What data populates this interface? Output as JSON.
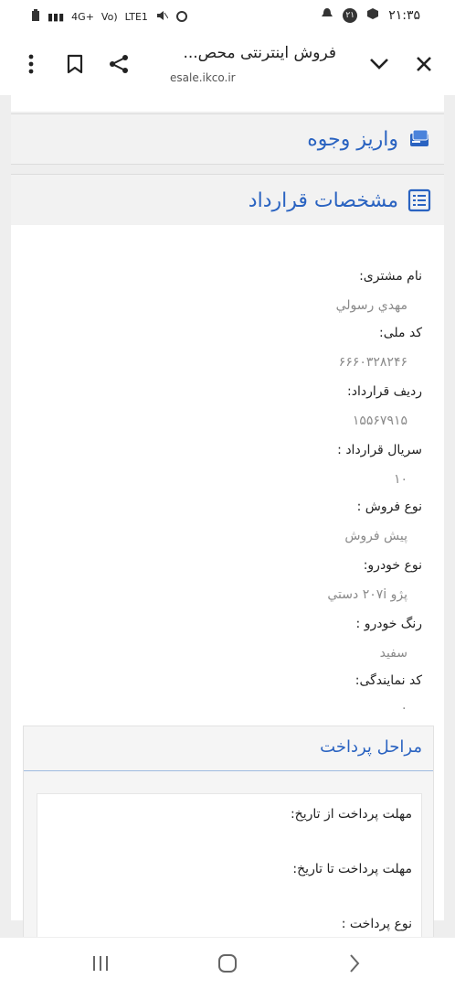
{
  "status_bar": {
    "time": "۲۱:۳۵",
    "left_indicators": [
      "4G+",
      "Vo)",
      "LTE1"
    ],
    "notification_badge": "۲۱"
  },
  "toolbar": {
    "page_title": "فروش اینترنتی محص...",
    "url": "esale.ikco.ir"
  },
  "sections": {
    "deposit_title": "واریز وجوه",
    "contract_title": "مشخصات قرارداد"
  },
  "contract_fields": [
    {
      "label": "نام مشتری:",
      "value": "مهدي رسولي"
    },
    {
      "label": "کد ملی:",
      "value": "۶۶۶۰۳۲۸۲۴۶"
    },
    {
      "label": "ردیف قرارداد:",
      "value": "۱۵۵۶۷۹۱۵"
    },
    {
      "label": "سریال قرارداد :",
      "value": "۱۰"
    },
    {
      "label": "نوع فروش :",
      "value": "پیش فروش"
    },
    {
      "label": "نوع خودرو:",
      "value": "پژو ۲۰۷i دستي"
    },
    {
      "label": "رنگ خودرو :",
      "value": "سفید"
    },
    {
      "label": "کد نمایندگی:",
      "value": "۰"
    }
  ],
  "payment": {
    "title": "مراحل پرداخت",
    "labels": [
      "مهلت پرداخت از تاریخ:",
      "مهلت پرداخت تا تاریخ:",
      "نوع پرداخت :"
    ]
  },
  "colors": {
    "accent": "#2a63c1",
    "panel_bg": "#f2f2f2",
    "page_bg": "#eeeeee"
  }
}
